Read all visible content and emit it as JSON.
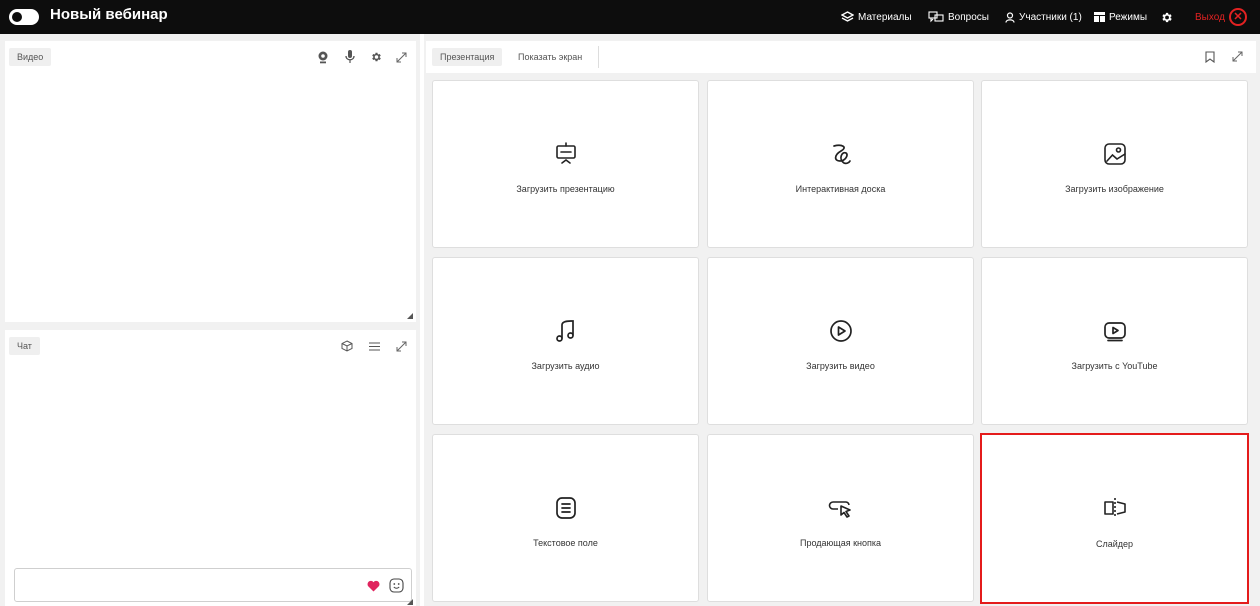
{
  "header": {
    "title": "Новый вебинар",
    "nav": {
      "materials": "Материалы",
      "questions": "Вопросы",
      "participants": "Участники (1)",
      "modes": "Режимы"
    },
    "exit": "Выход"
  },
  "video_panel": {
    "label": "Видео"
  },
  "chat_panel": {
    "label": "Чат",
    "input_value": ""
  },
  "right_panel": {
    "tabs": [
      "Презентация",
      "Показать экран"
    ],
    "active_tab": "Презентация"
  },
  "cards": [
    {
      "label": "Загрузить презентацию",
      "icon": "presentation-icon"
    },
    {
      "label": "Интерактивная доска",
      "icon": "whiteboard-squiggle-icon"
    },
    {
      "label": "Загрузить изображение",
      "icon": "image-icon"
    },
    {
      "label": "Загрузить аудио",
      "icon": "music-note-icon"
    },
    {
      "label": "Загрузить видео",
      "icon": "play-circle-icon"
    },
    {
      "label": "Загрузить с YouTube",
      "icon": "youtube-icon"
    },
    {
      "label": "Текстовое поле",
      "icon": "text-field-icon"
    },
    {
      "label": "Продающая кнопка",
      "icon": "cursor-button-icon"
    },
    {
      "label": "Слайдер",
      "icon": "slider-icon"
    }
  ],
  "selected_card": "Слайдер",
  "colors": {
    "topbar": "#0d0d0d",
    "exit": "#e32222",
    "selection": "#e41b1b",
    "heart": "#e0245e"
  }
}
